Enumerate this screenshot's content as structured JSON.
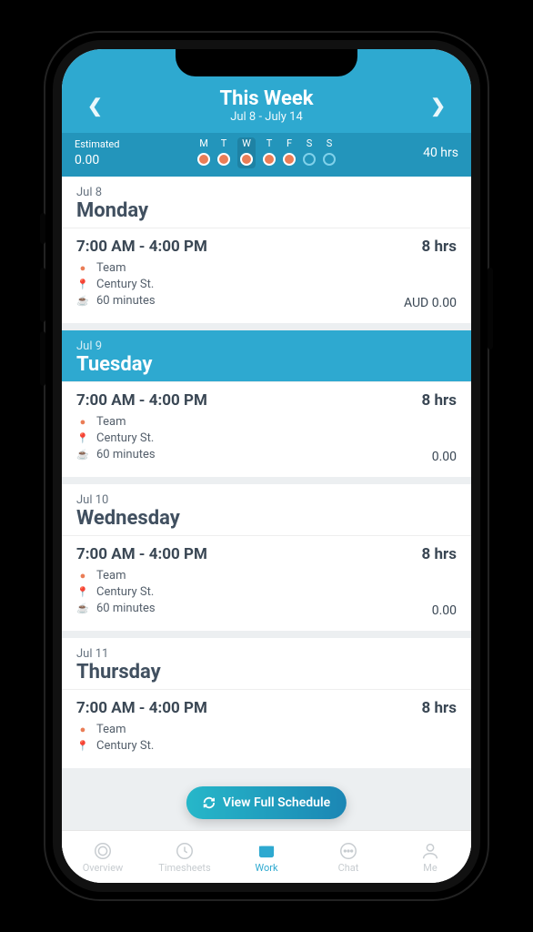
{
  "header": {
    "title": "This Week",
    "subtitle": "Jul 8 - July 14",
    "estimated_label": "Estimated",
    "estimated_value": "0.00",
    "week_total": "40 hrs",
    "days": [
      {
        "letter": "M",
        "filled": true,
        "current": false
      },
      {
        "letter": "T",
        "filled": true,
        "current": false
      },
      {
        "letter": "W",
        "filled": true,
        "current": true
      },
      {
        "letter": "T",
        "filled": true,
        "current": false
      },
      {
        "letter": "F",
        "filled": true,
        "current": false
      },
      {
        "letter": "S",
        "filled": false,
        "current": false
      },
      {
        "letter": "S",
        "filled": false,
        "current": false
      }
    ]
  },
  "schedule": [
    {
      "date": "Jul 8",
      "day": "Monday",
      "highlight": false,
      "time": "7:00 AM - 4:00 PM",
      "hours": "8 hrs",
      "team": "Team",
      "location": "Century St.",
      "break": "60 minutes",
      "cost": "AUD 0.00"
    },
    {
      "date": "Jul 9",
      "day": "Tuesday",
      "highlight": true,
      "time": "7:00 AM - 4:00 PM",
      "hours": "8 hrs",
      "team": "Team",
      "location": "Century St.",
      "break": "60 minutes",
      "cost": "0.00"
    },
    {
      "date": "Jul 10",
      "day": "Wednesday",
      "highlight": false,
      "time": "7:00 AM - 4:00 PM",
      "hours": "8 hrs",
      "team": "Team",
      "location": "Century St.",
      "break": "60 minutes",
      "cost": "0.00"
    },
    {
      "date": "Jul 11",
      "day": "Thursday",
      "highlight": false,
      "time": "7:00 AM - 4:00 PM",
      "hours": "8 hrs",
      "team": "Team",
      "location": "Century St.",
      "break": "",
      "cost": ""
    }
  ],
  "view_full_label": "View Full Schedule",
  "tabs": [
    {
      "label": "Overview",
      "active": false
    },
    {
      "label": "Timesheets",
      "active": false
    },
    {
      "label": "Work",
      "active": true
    },
    {
      "label": "Chat",
      "active": false
    },
    {
      "label": "Me",
      "active": false
    }
  ]
}
